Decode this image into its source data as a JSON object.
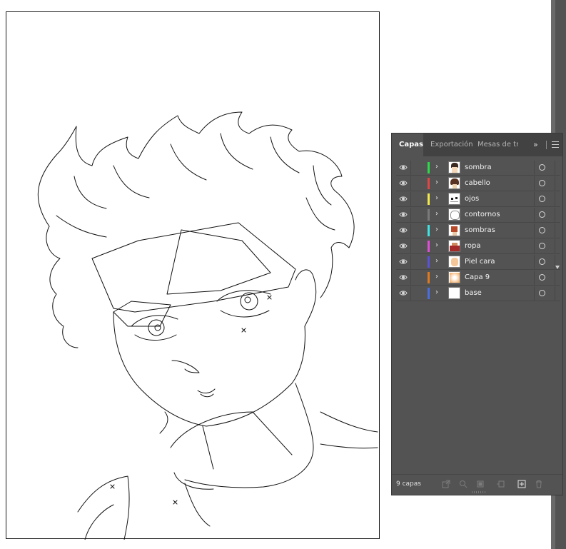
{
  "tabs": [
    {
      "label": "Capas",
      "active": true
    },
    {
      "label": "Exportación",
      "active": false
    },
    {
      "label": "Mesas de tra",
      "active": false
    }
  ],
  "tab_more_icon": "double-chevron-right-icon",
  "tab_menu_icon": "hamburger-menu-icon",
  "layers": [
    {
      "name": "sombra",
      "color": "#2bd94a",
      "visible": true
    },
    {
      "name": "cabello",
      "color": "#e04646",
      "visible": true
    },
    {
      "name": "ojos",
      "color": "#f2e94a",
      "visible": true
    },
    {
      "name": "contornos",
      "color": "#7a7a7a",
      "visible": true
    },
    {
      "name": "sombras",
      "color": "#3fe3e3",
      "visible": true
    },
    {
      "name": "ropa",
      "color": "#e04ed6",
      "visible": true
    },
    {
      "name": "Piel cara",
      "color": "#5a52d8",
      "visible": true
    },
    {
      "name": "Capa 9",
      "color": "#e07a1e",
      "visible": true
    },
    {
      "name": "base",
      "color": "#4a6ee0",
      "visible": true
    }
  ],
  "footer": {
    "count_label": "9 capas",
    "buttons": [
      "export-icon",
      "locate-object-icon",
      "clipping-mask-icon",
      "sublayer-icon",
      "new-layer-icon",
      "trash-icon"
    ]
  },
  "colors": {
    "panel_bg": "#535353",
    "tabbar_bg": "#424242",
    "ui_dark": "#535353",
    "artboard_bg": "#ffffff"
  }
}
